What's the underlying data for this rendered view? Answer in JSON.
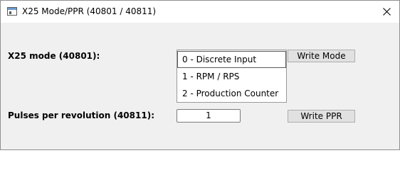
{
  "window": {
    "title": "X25 Mode/PPR (40801 / 40811)",
    "icons": {
      "app": "app-window-icon",
      "close": "close-icon"
    }
  },
  "mode": {
    "label": "X25 mode (40801):",
    "options": [
      "0 - Discrete Input",
      "1 - RPM / RPS",
      "2 - Production Counter"
    ],
    "selected": "0 - Discrete Input",
    "write_label": "Write Mode"
  },
  "ppr": {
    "label": "Pulses per revolution (40811):",
    "value": "1",
    "write_label": "Write PPR"
  }
}
